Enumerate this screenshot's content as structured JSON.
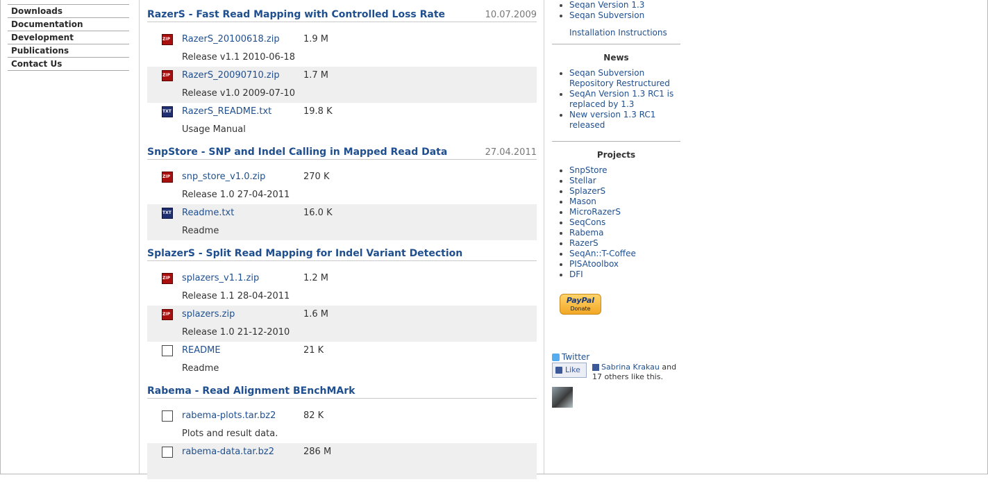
{
  "left_nav": {
    "items": [
      "Downloads",
      "Documentation",
      "Development",
      "Publications",
      "Contact Us"
    ]
  },
  "sections": [
    {
      "title": "RazerS - Fast Read Mapping with Controlled Loss Rate",
      "date": "10.07.2009",
      "files": [
        {
          "icon": "zip-icon",
          "name": "RazerS_20100618.zip",
          "size": "1.9 M",
          "desc": "Release v1.1 2010-06-18",
          "shaded": false
        },
        {
          "icon": "zip-icon",
          "name": "RazerS_20090710.zip",
          "size": "1.7 M",
          "desc": "Release v1.0 2009-07-10",
          "shaded": true
        },
        {
          "icon": "txt-icon",
          "name": "RazerS_README.txt",
          "size": "19.8 K",
          "desc": "Usage Manual",
          "shaded": false
        }
      ]
    },
    {
      "title": "SnpStore - SNP and Indel Calling in Mapped Read Data",
      "date": "27.04.2011",
      "files": [
        {
          "icon": "zip-icon",
          "name": "snp_store_v1.0.zip",
          "size": "270 K",
          "desc": "Release 1.0 27-04-2011",
          "shaded": false
        },
        {
          "icon": "txt-icon",
          "name": "Readme.txt",
          "size": "16.0 K",
          "desc": "Readme",
          "shaded": true
        }
      ]
    },
    {
      "title": "SplazerS - Split Read Mapping for Indel Variant Detection",
      "date": "",
      "files": [
        {
          "icon": "zip-icon",
          "name": "splazers_v1.1.zip",
          "size": "1.2 M",
          "desc": "Release 1.1 28-04-2011",
          "shaded": false
        },
        {
          "icon": "zip-icon",
          "name": "splazers.zip",
          "size": "1.6 M",
          "desc": "Release 1.0 21-12-2010",
          "shaded": true
        },
        {
          "icon": "doc-icon",
          "name": "README",
          "size": "21 K",
          "desc": "Readme",
          "shaded": false
        }
      ]
    },
    {
      "title": "Rabema - Read Alignment BEnchMArk",
      "date": "",
      "files": [
        {
          "icon": "doc-icon",
          "name": "rabema-plots.tar.bz2",
          "size": "82 K",
          "desc": "Plots and result data.",
          "shaded": false
        },
        {
          "icon": "doc-icon",
          "name": "rabema-data.tar.bz2",
          "size": "286 M",
          "desc": "",
          "shaded": true
        }
      ]
    }
  ],
  "sidebar": {
    "top_links": [
      "Seqan Version 1.3",
      "Seqan Subversion"
    ],
    "install_link": "Installation Instructions",
    "news_title": "News",
    "news": [
      "Seqan Subversion Repository Restructured",
      "SeqAn Version 1.3 RC1 is replaced by 1.3",
      "New version 1.3 RC1 released"
    ],
    "projects_title": "Projects",
    "projects": [
      "SnpStore",
      "Stellar",
      "SplazerS",
      "Mason",
      "MicroRazerS",
      "SeqCons",
      "Rabema",
      "RazerS",
      "SeqAn::T-Coffee",
      "PISAtoolbox",
      "DFI"
    ],
    "paypal_brand": "PayPal",
    "paypal_label": "Donate",
    "twitter_label": "Twitter",
    "like_label": "Like",
    "fb_friend": "Sabrina Krakau",
    "fb_suffix": "and 17 others like this."
  },
  "colors": {
    "link": "#1f4f8f",
    "shaded_row": "#efefef"
  }
}
